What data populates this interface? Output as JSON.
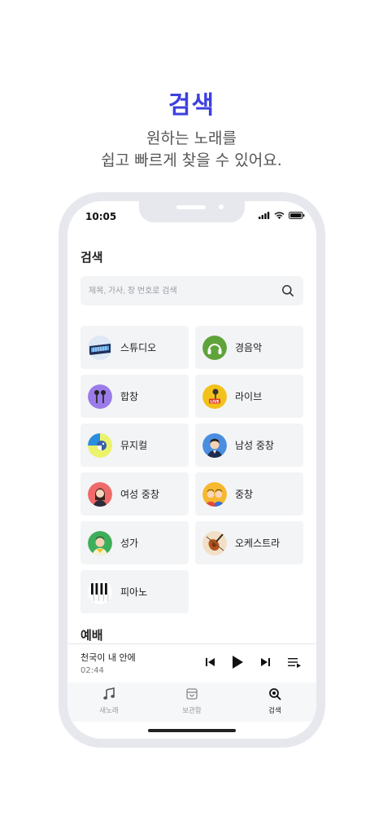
{
  "promo": {
    "title": "검색",
    "subtitle_line1": "원하는 노래를",
    "subtitle_line2": "쉽고 빠르게 찾을 수 있어요."
  },
  "status_bar": {
    "time": "10:05"
  },
  "page": {
    "title": "검색"
  },
  "search": {
    "placeholder": "제목, 가사, 장 번호로 검색",
    "value": ""
  },
  "categories": [
    {
      "label": "스튜디오",
      "icon": "studio-icon"
    },
    {
      "label": "경음악",
      "icon": "light-music-icon"
    },
    {
      "label": "합창",
      "icon": "choir-icon"
    },
    {
      "label": "라이브",
      "icon": "live-icon"
    },
    {
      "label": "뮤지컬",
      "icon": "musical-icon"
    },
    {
      "label": "남성 중창",
      "icon": "male-ensemble-icon"
    },
    {
      "label": "여성 중창",
      "icon": "female-ensemble-icon"
    },
    {
      "label": "중창",
      "icon": "ensemble-icon"
    },
    {
      "label": "성가",
      "icon": "chant-icon"
    },
    {
      "label": "오케스트라",
      "icon": "orchestra-icon"
    },
    {
      "label": "피아노",
      "icon": "piano-icon"
    }
  ],
  "section": {
    "title": "예배"
  },
  "player": {
    "song": "천국이 내 안에",
    "time": "02:44"
  },
  "tabs": [
    {
      "label": "새노래",
      "icon": "music-note-icon",
      "active": false
    },
    {
      "label": "보관함",
      "icon": "archive-icon",
      "active": false
    },
    {
      "label": "검색",
      "icon": "search-icon",
      "active": true
    }
  ],
  "colors": {
    "accent": "#3d3fe0",
    "card_bg": "#f3f4f6",
    "frame": "#e6e8ee"
  }
}
